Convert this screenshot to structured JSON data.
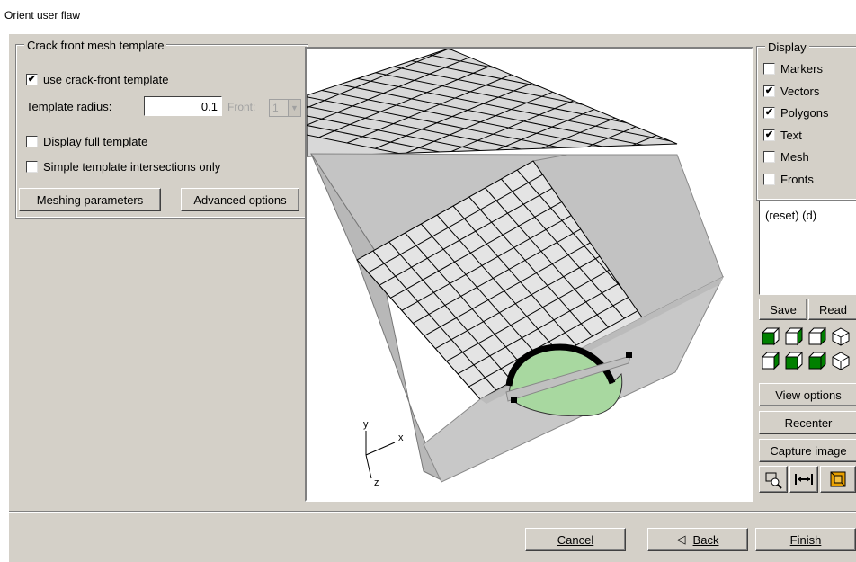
{
  "window": {
    "title": "Orient user flaw"
  },
  "crack_group": {
    "legend": "Crack front mesh template",
    "use_template": {
      "label": "use crack-front template",
      "checked": true
    },
    "radius_label": "Template radius:",
    "radius_value": "0.1",
    "front_label": "Front:",
    "front_value": "1",
    "display_full": {
      "label": "Display full template",
      "checked": false
    },
    "simple_intersections": {
      "label": "Simple template intersections only",
      "checked": false
    },
    "meshing_button": "Meshing parameters",
    "advanced_button": "Advanced options"
  },
  "display_group": {
    "legend": "Display",
    "items": [
      {
        "label": "Markers",
        "checked": false
      },
      {
        "label": "Vectors",
        "checked": true
      },
      {
        "label": "Polygons",
        "checked": true
      },
      {
        "label": "Text",
        "checked": true
      },
      {
        "label": "Mesh",
        "checked": false
      },
      {
        "label": "Fronts",
        "checked": false
      }
    ]
  },
  "history": {
    "text": "(reset) (d)"
  },
  "right_buttons": {
    "save": "Save",
    "read": "Read",
    "view_options": "View options",
    "recenter": "Recenter",
    "capture": "Capture image"
  },
  "axes": {
    "x": "x",
    "y": "y",
    "z": "z"
  },
  "footer": {
    "cancel": "Cancel",
    "back": "Back",
    "finish": "Finish"
  },
  "colors": {
    "panel": "#d4d0c8",
    "flaw": "#a8d8a0",
    "cube_green": "#008000"
  }
}
